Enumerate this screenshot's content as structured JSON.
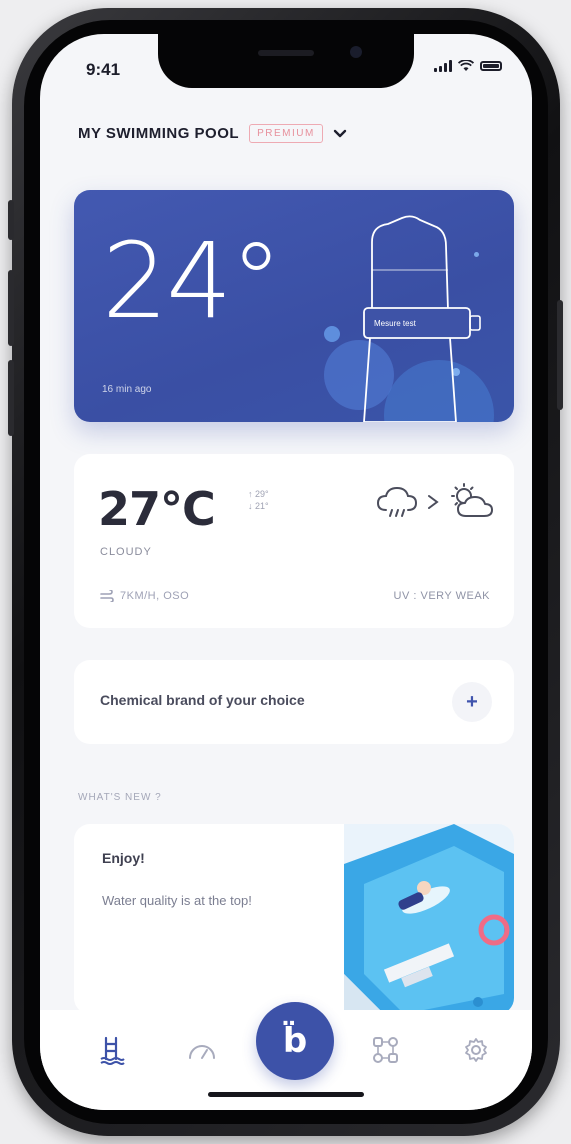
{
  "status_bar": {
    "time": "9:41"
  },
  "header": {
    "title": "MY SWIMMING POOL",
    "badge": "PREMIUM",
    "chevron_icon": "chevron-down-icon"
  },
  "temperature_card": {
    "value": "24°",
    "device_label": "Mesure test",
    "updated": "16 min ago",
    "accent": "#3e53a7"
  },
  "weather": {
    "temperature": "27°C",
    "max": "↑ 29°",
    "min": "↓ 21°",
    "condition": "CLOUDY",
    "wind": "7KM/H, OSO",
    "uv": "UV : VERY WEAK"
  },
  "chemical": {
    "label": "Chemical brand of your choice",
    "add_label": "+"
  },
  "whats_new": {
    "section_label": "WHAT'S NEW ?",
    "title": "Enjoy!",
    "text": "Water quality is at the top!"
  },
  "tabbar": {
    "center_label": "b̈",
    "items": [
      "pool-ladder-icon",
      "gauge-icon",
      "home-logo",
      "connected-devices-icon",
      "settings-gear-icon"
    ]
  }
}
